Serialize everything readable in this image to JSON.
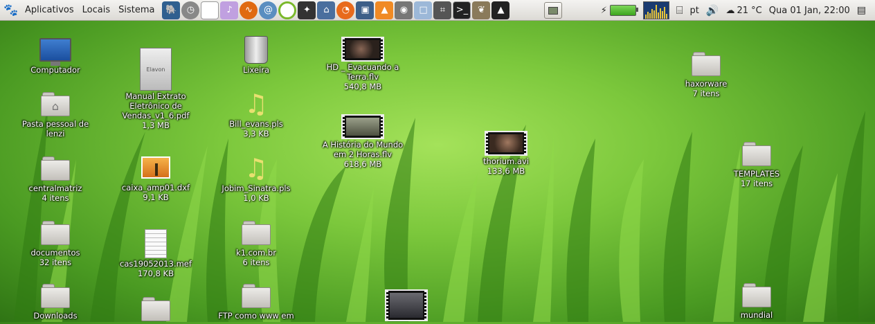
{
  "panel": {
    "menus": [
      "Aplicativos",
      "Locais",
      "Sistema"
    ],
    "launchers": [
      "postgres-elephant-icon",
      "clock-icon",
      "text-document-icon",
      "media-player-icon",
      "audio-app-icon",
      "network-swirl-icon",
      "green-ring-icon",
      "diagram-icon",
      "network-computer-icon",
      "firefox-icon",
      "monitor-icon",
      "vlc-cone-icon",
      "camera-icon",
      "window-icon",
      "calculator-icon",
      "terminal-icon",
      "gimp-icon",
      "inkscape-icon"
    ],
    "temperature": "21 °C",
    "clock": "Qua 01 Jan, 22:00",
    "keyboard_layout": "pt"
  },
  "desktop": {
    "col1": [
      {
        "name": "Computador",
        "sub": "",
        "kind": "computer"
      },
      {
        "name": "Pasta pessoal de\nlenzi",
        "sub": "",
        "kind": "home"
      },
      {
        "name": "centralmatriz",
        "sub": "4 itens",
        "kind": "folder"
      },
      {
        "name": "documentos",
        "sub": "32 itens",
        "kind": "folder"
      },
      {
        "name": "Downloads",
        "sub": "",
        "kind": "folder"
      }
    ],
    "col2": [
      {
        "name": "Manual Extrato\nEletrônico de\nVendas_v1_6.pdf",
        "sub": "1,3 MB",
        "kind": "pdf"
      },
      {
        "name": "caixa_amp01.dxf",
        "sub": "9,1 KB",
        "kind": "image"
      },
      {
        "name": "cas19052013.mef",
        "sub": "170,8 KB",
        "kind": "text"
      },
      {
        "name": "",
        "sub": "",
        "kind": "folder"
      }
    ],
    "col3": [
      {
        "name": "Lixeira",
        "sub": "",
        "kind": "trash"
      },
      {
        "name": "Bill_evans.pls",
        "sub": "3,3 KB",
        "kind": "music"
      },
      {
        "name": "Jobim_Sinatra.pls",
        "sub": "1,0 KB",
        "kind": "music"
      },
      {
        "name": "k1.com.br",
        "sub": "6 itens",
        "kind": "folder"
      },
      {
        "name": "FTP como www em",
        "sub": "",
        "kind": "netfolder"
      }
    ],
    "col4": [
      {
        "name": "HD _ Evacuando a\nTerra.flv",
        "sub": "540,8 MB",
        "kind": "video"
      },
      {
        "name": "A História do Mundo\nem 2 Horas.flv",
        "sub": "618,6 MB",
        "kind": "video"
      },
      {
        "name": "",
        "sub": "",
        "kind": "video"
      }
    ],
    "col5": [
      {
        "name": "thorium.avi",
        "sub": "133,6 MB",
        "kind": "video"
      }
    ],
    "col6": [
      {
        "name": "haxorware",
        "sub": "7 itens",
        "kind": "folder"
      },
      {
        "name": "TEMPLATES",
        "sub": "17 itens",
        "kind": "folder"
      },
      {
        "name": "mundial",
        "sub": "",
        "kind": "folder"
      }
    ]
  }
}
